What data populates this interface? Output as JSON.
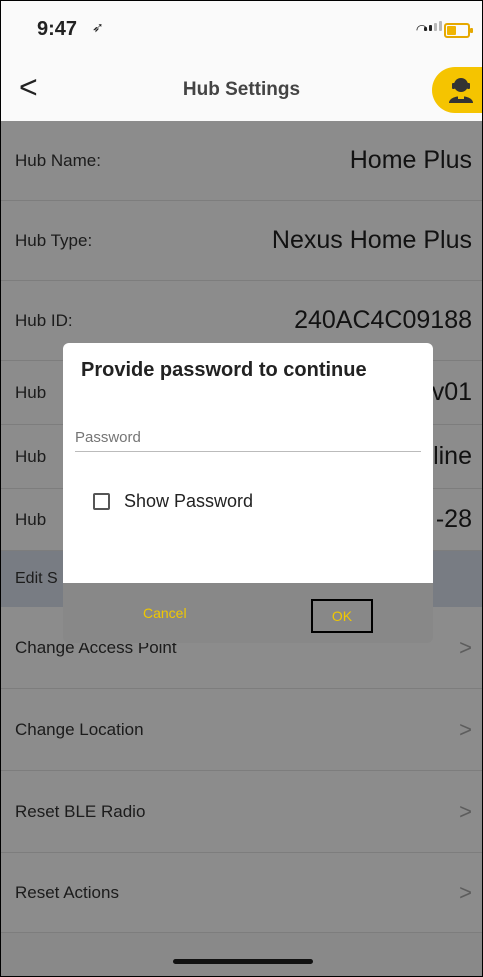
{
  "status": {
    "time": "9:47",
    "location_arrow": "➶"
  },
  "header": {
    "title": "Hub Settings",
    "back_glyph": "<"
  },
  "info_rows": [
    {
      "label": "Hub Name:",
      "value": "Home Plus"
    },
    {
      "label": "Hub Type:",
      "value": "Nexus Home Plus"
    },
    {
      "label": "Hub ID:",
      "value": "240AC4C09188"
    },
    {
      "label": "Hub",
      "value": "v01"
    },
    {
      "label": "Hub",
      "value": "line"
    },
    {
      "label": "Hub",
      "value": "-28"
    }
  ],
  "section": {
    "label": "Edit S"
  },
  "action_rows": [
    {
      "label": "Change Access Point",
      "chevron": ">"
    },
    {
      "label": "Change Location",
      "chevron": ">"
    },
    {
      "label": "Reset BLE Radio",
      "chevron": ">"
    },
    {
      "label": "Reset Actions",
      "chevron": ">"
    }
  ],
  "dialog": {
    "title": "Provide password to continue",
    "password_placeholder": "Password",
    "show_password_label": "Show Password",
    "show_password_checked": false,
    "cancel_label": "Cancel",
    "ok_label": "OK"
  },
  "colors": {
    "accent": "#f5c400",
    "dialog_action_text": "#f0c800",
    "section_bg": "#dbe2ee"
  }
}
